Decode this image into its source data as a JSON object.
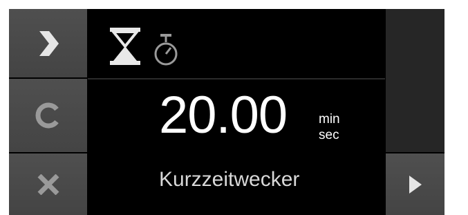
{
  "display": {
    "time_value": "20.00",
    "unit_top": "min",
    "unit_bottom": "sec",
    "mode_label": "Kurzzeitwecker"
  },
  "modes": {
    "active": "hourglass-icon",
    "inactive": "stopwatch-icon"
  },
  "buttons": {
    "left": [
      "chevron-right-icon",
      "refresh-c-icon",
      "close-x-icon"
    ],
    "right": [
      "play-triangle-icon"
    ]
  },
  "colors": {
    "background": "#000000",
    "button": "#4a4a4a",
    "panel": "#262626",
    "text": "#ffffff",
    "icon_active": "#e8e8e8",
    "icon_inactive": "#9a9a9a"
  }
}
